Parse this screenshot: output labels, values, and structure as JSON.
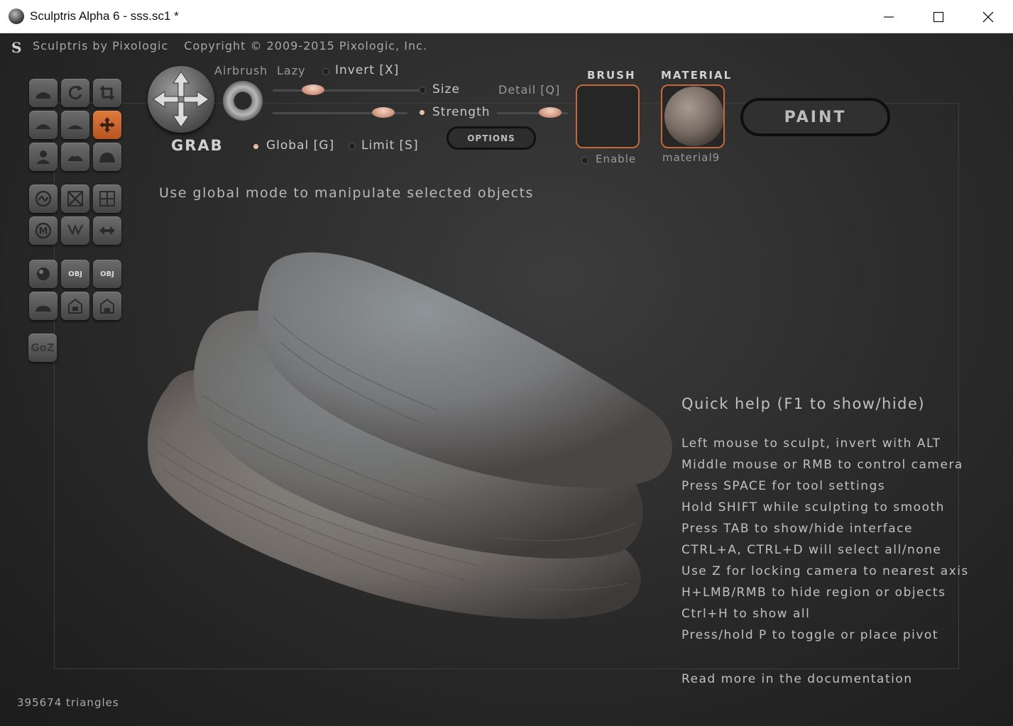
{
  "window": {
    "title": "Sculptris Alpha 6 - sss.sc1 *"
  },
  "topbar": {
    "logo": "S",
    "product": "Sculptris by Pixologic",
    "copyright": "Copyright © 2009-2015 Pixologic, Inc."
  },
  "tools": [
    {
      "name": "crease-tool",
      "icon": "crease-icon"
    },
    {
      "name": "rotate-tool",
      "icon": "rotate-icon"
    },
    {
      "name": "scale-tool",
      "icon": "scale-icon"
    },
    {
      "name": "inflate-tool",
      "icon": "inflate-icon"
    },
    {
      "name": "smooth-tool",
      "icon": "smooth-icon"
    },
    {
      "name": "grab-tool",
      "icon": "grab-icon"
    },
    {
      "name": "pinch-tool",
      "icon": "pinch-icon"
    },
    {
      "name": "flatten-tool",
      "icon": "flatten-icon"
    },
    {
      "name": "draw-tool",
      "icon": "draw-icon"
    },
    {
      "name": "reduce-brush-tool",
      "icon": "reduce-icon"
    },
    {
      "name": "reduce-selected-tool",
      "icon": "reduce-selected-icon"
    },
    {
      "name": "subdivide-tool",
      "icon": "subdivide-icon"
    },
    {
      "name": "mask-tool",
      "icon": "mask-icon"
    },
    {
      "name": "wireframe-tool",
      "icon": "wireframe-icon"
    },
    {
      "name": "symmetry-tool",
      "icon": "symmetry-icon"
    },
    {
      "name": "new-sphere-button",
      "icon": "sphere-icon"
    },
    {
      "name": "import-obj-button",
      "icon": "import-obj-icon",
      "label": "OBJ"
    },
    {
      "name": "export-obj-button",
      "icon": "export-obj-icon",
      "label": "OBJ"
    },
    {
      "name": "new-plane-button",
      "icon": "plane-icon"
    },
    {
      "name": "open-button",
      "icon": "open-icon"
    },
    {
      "name": "save-button",
      "icon": "save-icon"
    },
    {
      "name": "goz-button",
      "icon": "goz-icon",
      "label": "GoZ"
    }
  ],
  "brush": {
    "tool_name": "GRAB",
    "airbrush_label": "Airbrush",
    "lazy_label": "Lazy",
    "invert_label": "Invert [X]",
    "size_label": "Size",
    "strength_label": "Strength",
    "detail_label": "Detail [Q]",
    "global_label": "Global [G]",
    "limit_label": "Limit [S]",
    "options_label": "OPTIONS",
    "brush_header": "BRUSH",
    "material_header": "MATERIAL",
    "enable_label": "Enable",
    "material_name": "material9",
    "paint_label": "PAINT",
    "size_value": 0.27,
    "strength_value": 0.82,
    "detail_value": 0.75,
    "invert_on": false,
    "global_on": true,
    "limit_on": false,
    "enable_on": false,
    "strength_on": true,
    "size_on": false
  },
  "hint": "Use global mode to manipulate selected objects",
  "quick_help": {
    "title": "Quick help (F1 to show/hide)",
    "lines": [
      "Left mouse to sculpt, invert with ALT",
      "Middle mouse or RMB to control camera",
      "Press SPACE for tool settings",
      "Hold SHIFT while sculpting to smooth",
      "Press TAB to show/hide interface",
      "CTRL+A, CTRL+D will select all/none",
      "Use Z for locking camera to nearest axis",
      "H+LMB/RMB to hide region or objects",
      "Ctrl+H to show all",
      "Press/hold P to toggle or place pivot"
    ],
    "footer": "Read more in the documentation"
  },
  "status": {
    "triangles": "395674 triangles"
  },
  "colors": {
    "accent": "#c7683a",
    "active_tool": "#e07a3e",
    "knob": "#e8b8a0"
  }
}
